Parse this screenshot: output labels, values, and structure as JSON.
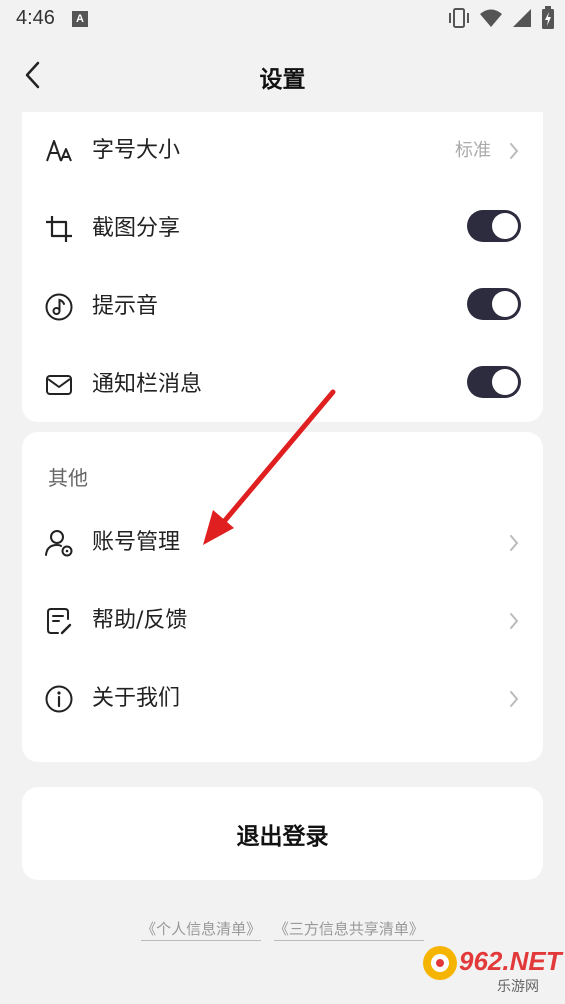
{
  "status_bar": {
    "time": "4:46",
    "notification_badge": "A"
  },
  "header": {
    "title": "设置",
    "back_icon": "chevron-left-icon"
  },
  "settings": [
    {
      "label": "字号大小",
      "value": "标准",
      "icon": "font-size-icon",
      "control": "chevron"
    },
    {
      "label": "截图分享",
      "icon": "crop-icon",
      "control": "toggle",
      "on": true
    },
    {
      "label": "提示音",
      "icon": "music-note-icon",
      "control": "toggle",
      "on": true
    },
    {
      "label": "通知栏消息",
      "icon": "mail-icon",
      "control": "toggle",
      "on": true
    }
  ],
  "other": {
    "title": "其他",
    "items": [
      {
        "label": "账号管理",
        "icon": "user-gear-icon"
      },
      {
        "label": "帮助/反馈",
        "icon": "feedback-icon"
      },
      {
        "label": "关于我们",
        "icon": "info-icon"
      }
    ]
  },
  "logout": {
    "label": "退出登录"
  },
  "footer": {
    "links": [
      "《个人信息清单》",
      "《三方信息共享清单》"
    ]
  },
  "watermark": {
    "text": "962.NET",
    "sub": "乐游网"
  },
  "colors": {
    "toggle_on": "#2d2c3e",
    "background": "#f2f2f2",
    "annotation_arrow": "#e02020"
  }
}
